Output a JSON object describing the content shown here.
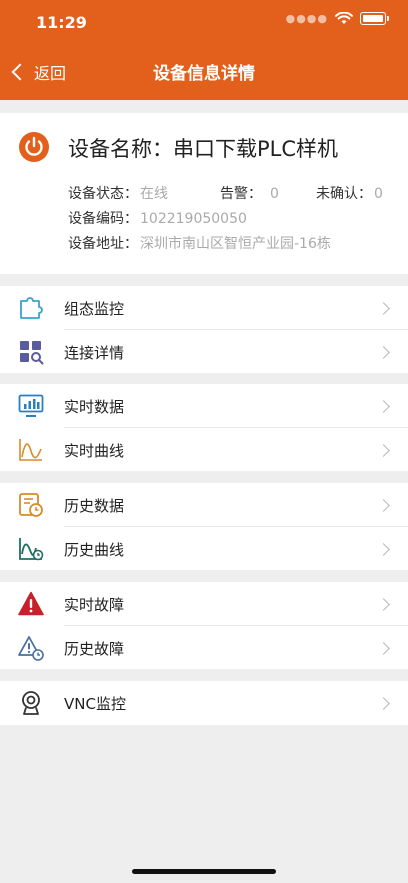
{
  "status_bar": {
    "time": "11:29"
  },
  "nav": {
    "back_label": "返回",
    "title": "设备信息详情"
  },
  "device": {
    "name": "设备名称：串口下载PLC样机",
    "status_label": "设备状态：",
    "status_value": "在线",
    "alarm_label": "告警：",
    "alarm_value": "0",
    "unconfirmed_label": "未确认：",
    "unconfirmed_value": "0",
    "code_label": "设备编码：",
    "code_value": "102219050050",
    "address_label": "设备地址：",
    "address_value": "深圳市南山区智恒产业园-16栋"
  },
  "menu": [
    {
      "label": "组态监控",
      "icon": "puzzle-icon"
    },
    {
      "label": "连接详情",
      "icon": "grid-search-icon"
    },
    {
      "label": "实时数据",
      "icon": "monitor-chart-icon"
    },
    {
      "label": "实时曲线",
      "icon": "curve-icon"
    },
    {
      "label": "历史数据",
      "icon": "history-data-icon"
    },
    {
      "label": "历史曲线",
      "icon": "history-curve-icon"
    },
    {
      "label": "实时故障",
      "icon": "warning-icon"
    },
    {
      "label": "历史故障",
      "icon": "history-warning-icon"
    },
    {
      "label": "VNC监控",
      "icon": "webcam-icon"
    }
  ],
  "colors": {
    "accent": "#e2601b",
    "online": "#aaaaaa",
    "red_alert": "#c8202a"
  }
}
